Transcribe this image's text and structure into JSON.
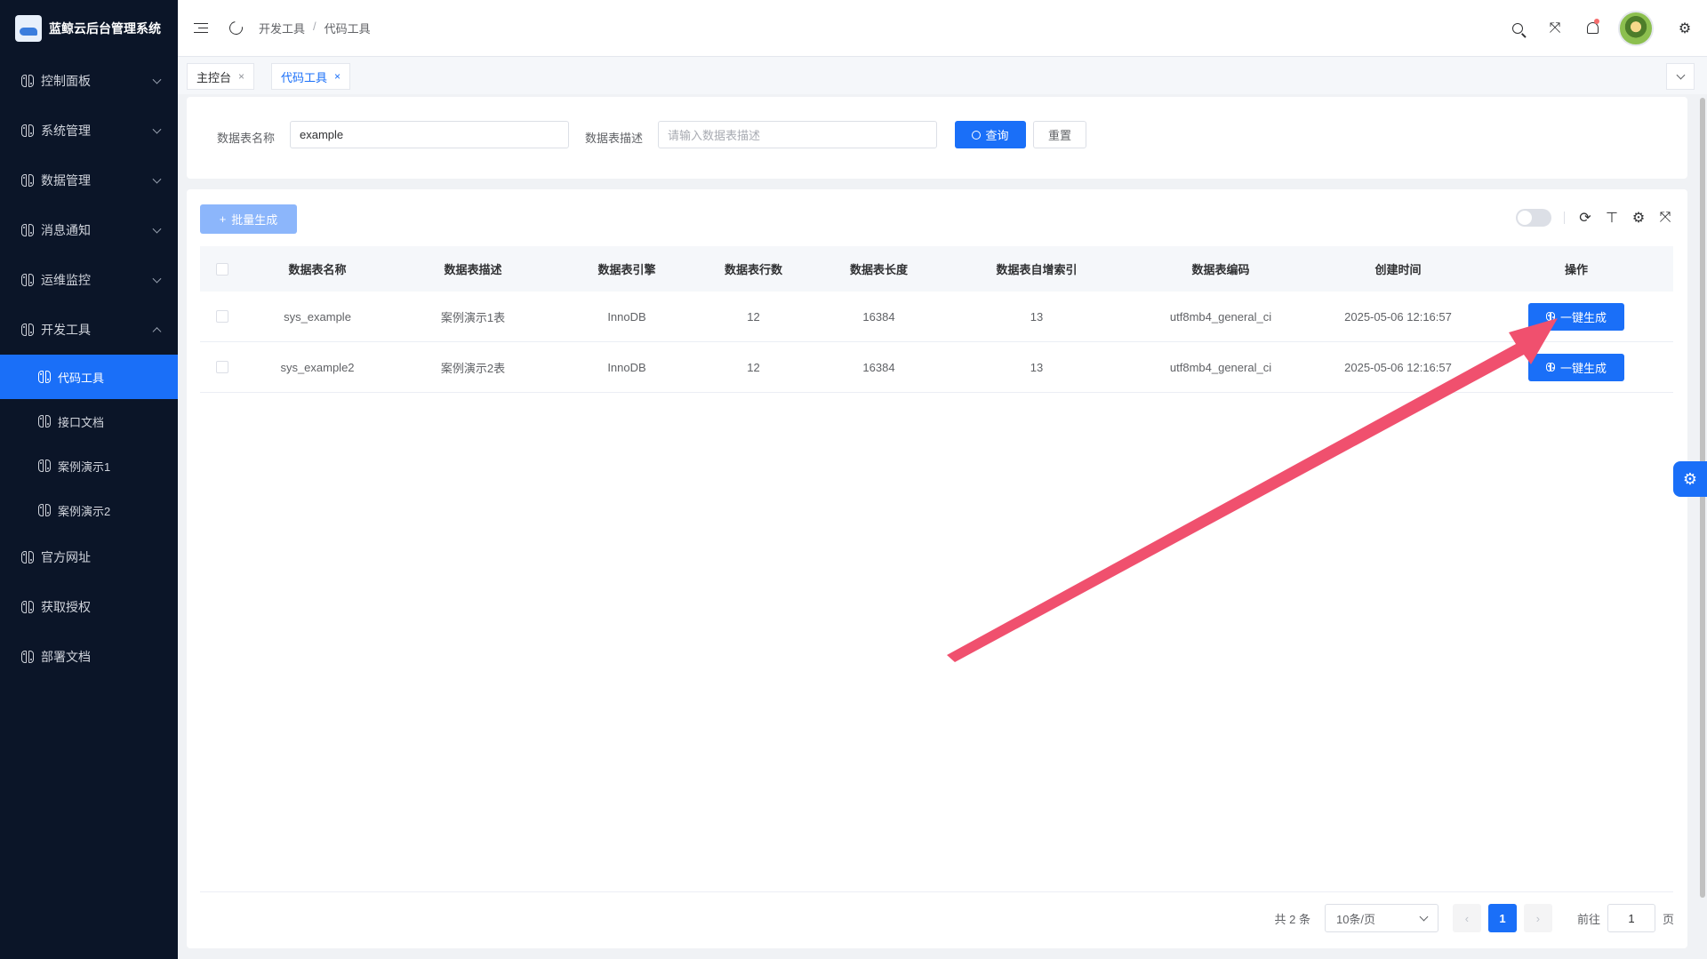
{
  "app": {
    "title": "蓝鲸云后台管理系统"
  },
  "sidebar": {
    "items": [
      {
        "label": "控制面板"
      },
      {
        "label": "系统管理"
      },
      {
        "label": "数据管理"
      },
      {
        "label": "消息通知"
      },
      {
        "label": "运维监控"
      },
      {
        "label": "开发工具"
      },
      {
        "label": "官方网址"
      },
      {
        "label": "获取授权"
      },
      {
        "label": "部署文档"
      }
    ],
    "dev_sub": [
      {
        "label": "代码工具",
        "active": true
      },
      {
        "label": "接口文档"
      },
      {
        "label": "案例演示1"
      },
      {
        "label": "案例演示2"
      }
    ]
  },
  "header": {
    "breadcrumb": [
      "开发工具",
      "代码工具"
    ],
    "breadcrumb_sep": "/"
  },
  "tabs": [
    {
      "label": "主控台",
      "close": "×"
    },
    {
      "label": "代码工具",
      "close": "×",
      "active": true
    }
  ],
  "search": {
    "name_label": "数据表名称",
    "name_value": "example",
    "desc_label": "数据表描述",
    "desc_placeholder": "请输入数据表描述",
    "query_label": "查询",
    "reset_label": "重置"
  },
  "table": {
    "batch_label": "批量生成",
    "columns": [
      "数据表名称",
      "数据表描述",
      "数据表引擎",
      "数据表行数",
      "数据表长度",
      "数据表自增索引",
      "数据表编码",
      "创建时间",
      "操作"
    ],
    "rows": [
      {
        "name": "sys_example",
        "desc": "案例演示1表",
        "engine": "InnoDB",
        "rows": "12",
        "length": "16384",
        "auto_inc": "13",
        "collation": "utf8mb4_general_ci",
        "created": "2025-05-06 12:16:57",
        "action": "一键生成"
      },
      {
        "name": "sys_example2",
        "desc": "案例演示2表",
        "engine": "InnoDB",
        "rows": "12",
        "length": "16384",
        "auto_inc": "13",
        "collation": "utf8mb4_general_ci",
        "created": "2025-05-06 12:16:57",
        "action": "一键生成"
      }
    ]
  },
  "pagination": {
    "total": "共 2 条",
    "page_size": "10条/页",
    "current": "1",
    "goto_label": "前往",
    "goto_value": "1",
    "page_suffix": "页"
  },
  "colors": {
    "primary": "#1a6ff8",
    "sidebar_bg": "#0b1528",
    "annotation_arrow": "#f0506e"
  }
}
